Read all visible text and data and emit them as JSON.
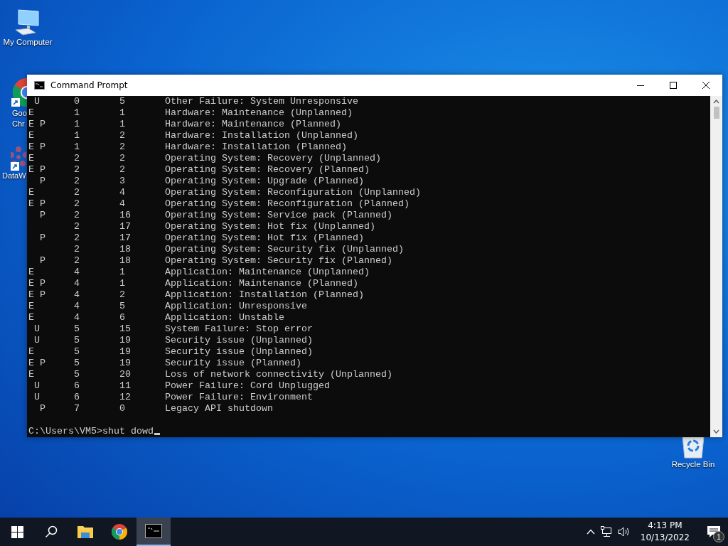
{
  "desktop_icons": [
    {
      "kind": "computer",
      "label_lines": [
        "My Computer"
      ]
    },
    {
      "kind": "chrome",
      "label_lines": [
        "Goo",
        "Chr"
      ]
    },
    {
      "kind": "data",
      "label_lines": [
        "DataW"
      ]
    },
    {
      "kind": "recycle",
      "label_lines": [
        "Recycle Bin"
      ]
    }
  ],
  "window": {
    "title": "Command Prompt",
    "output_lines": [
      " U      0       5       Other Failure: System Unresponsive",
      "E       1       1       Hardware: Maintenance (Unplanned)",
      "E P     1       1       Hardware: Maintenance (Planned)",
      "E       1       2       Hardware: Installation (Unplanned)",
      "E P     1       2       Hardware: Installation (Planned)",
      "E       2       2       Operating System: Recovery (Unplanned)",
      "E P     2       2       Operating System: Recovery (Planned)",
      "  P     2       3       Operating System: Upgrade (Planned)",
      "E       2       4       Operating System: Reconfiguration (Unplanned)",
      "E P     2       4       Operating System: Reconfiguration (Planned)",
      "  P     2       16      Operating System: Service pack (Planned)",
      "        2       17      Operating System: Hot fix (Unplanned)",
      "  P     2       17      Operating System: Hot fix (Planned)",
      "        2       18      Operating System: Security fix (Unplanned)",
      "  P     2       18      Operating System: Security fix (Planned)",
      "E       4       1       Application: Maintenance (Unplanned)",
      "E P     4       1       Application: Maintenance (Planned)",
      "E P     4       2       Application: Installation (Planned)",
      "E       4       5       Application: Unresponsive",
      "E       4       6       Application: Unstable",
      " U      5       15      System Failure: Stop error",
      " U      5       19      Security issue (Unplanned)",
      "E       5       19      Security issue (Unplanned)",
      "E P     5       19      Security issue (Planned)",
      "E       5       20      Loss of network connectivity (Unplanned)",
      " U      6       11      Power Failure: Cord Unplugged",
      " U      6       12      Power Failure: Environment",
      "  P     7       0       Legacy API shutdown"
    ],
    "prompt": "C:\\Users\\VM5>shut dowd"
  },
  "taskbar": {
    "apps": [
      {
        "kind": "explorer",
        "selected": false
      },
      {
        "kind": "chrome",
        "selected": false
      },
      {
        "kind": "cmd",
        "selected": true
      }
    ],
    "clock_time": "4:13 PM",
    "clock_date": "10/13/2022",
    "notification_count": "1"
  }
}
